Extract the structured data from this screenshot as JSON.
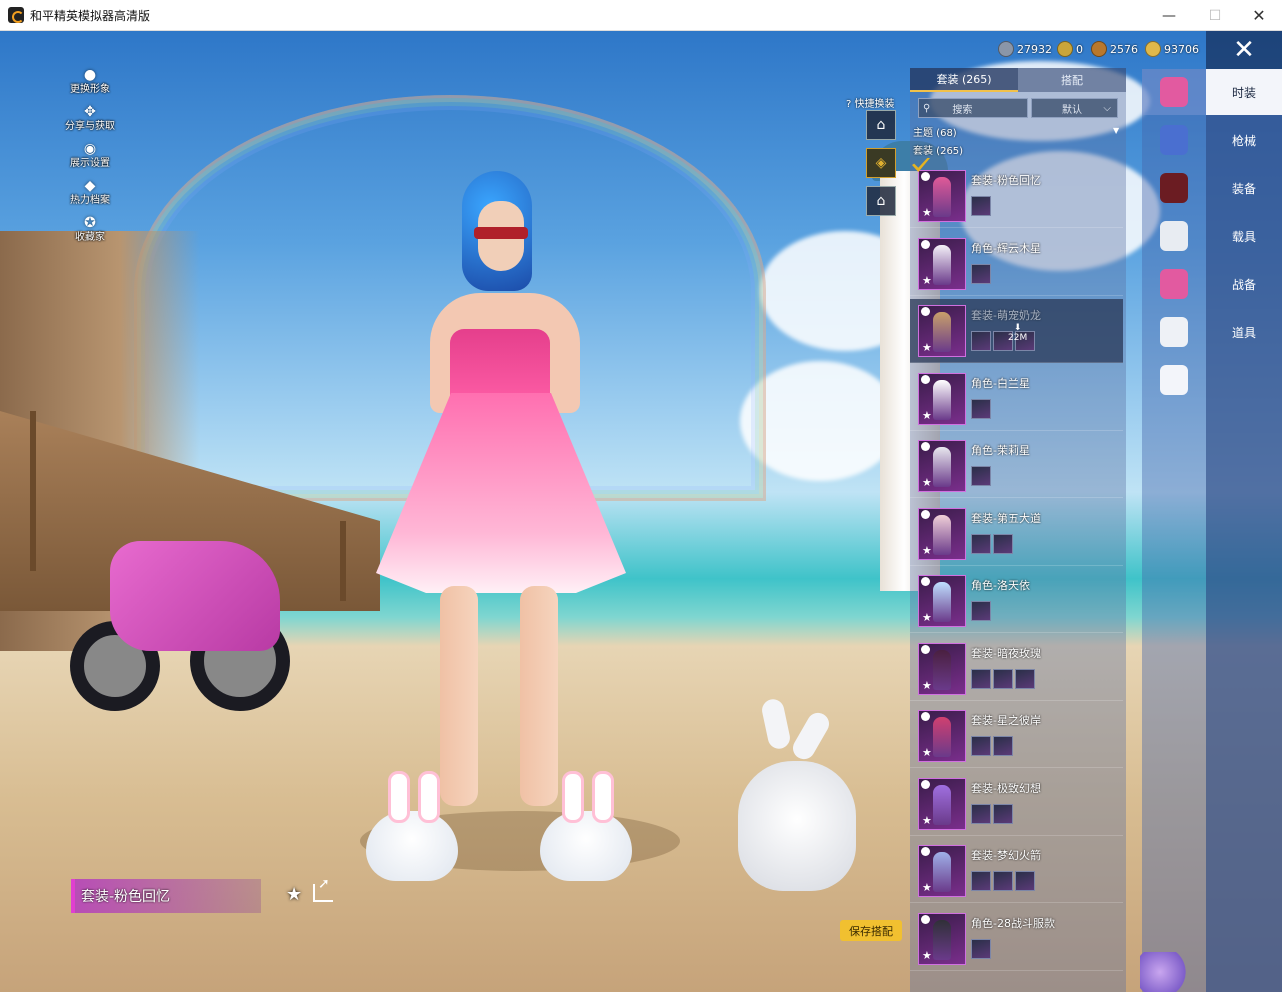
{
  "window": {
    "title": "和平精英模拟器高清版",
    "minimize": "—",
    "maximize": "☐",
    "close": "✕"
  },
  "left_menu": [
    {
      "label": "更换形象",
      "icon": "person-icon"
    },
    {
      "label": "分享与获取",
      "icon": "share-icon"
    },
    {
      "label": "展示设置",
      "icon": "eye-icon"
    },
    {
      "label": "热力档案",
      "icon": "profile-icon"
    },
    {
      "label": "收藏家",
      "icon": "collector-badge-icon"
    }
  ],
  "currency": [
    {
      "value": "27932",
      "color": "#8a96a8"
    },
    {
      "value": "0",
      "color": "#c9a53a"
    },
    {
      "value": "2576",
      "color": "#b9782c"
    },
    {
      "value": "93706",
      "color": "#e0b84a"
    }
  ],
  "close_button": "✕",
  "quick_change": {
    "label": "快捷换装"
  },
  "panel": {
    "tab_outfits": "套装 (265)",
    "tab_match": "搭配",
    "search_placeholder": "搜索",
    "sort_value": "默认",
    "group_theme": "主题 (68)",
    "group_outfits": "套装 (265)"
  },
  "outfits": [
    {
      "name": "套装-粉色回忆",
      "minis": 1,
      "selected": false,
      "checked": true
    },
    {
      "name": "角色-辉云木星",
      "minis": 1,
      "selected": false,
      "checked": false
    },
    {
      "name": "套装-萌宠奶龙",
      "minis": 3,
      "selected": true,
      "checked": false,
      "download": "22M"
    },
    {
      "name": "角色-白兰星",
      "minis": 1,
      "selected": false,
      "checked": false
    },
    {
      "name": "角色-茉莉星",
      "minis": 1,
      "selected": false,
      "checked": false
    },
    {
      "name": "套装-第五大道",
      "minis": 2,
      "selected": false,
      "checked": false
    },
    {
      "name": "角色-洛天依",
      "minis": 1,
      "selected": false,
      "checked": false
    },
    {
      "name": "套装-暗夜玫瑰",
      "minis": 3,
      "selected": false,
      "checked": false
    },
    {
      "name": "套装-星之彼岸",
      "minis": 2,
      "selected": false,
      "checked": false
    },
    {
      "name": "套装-极致幻想",
      "minis": 2,
      "selected": false,
      "checked": false
    },
    {
      "name": "套装-梦幻火箭",
      "minis": 3,
      "selected": false,
      "checked": false
    },
    {
      "name": "角色-28战斗服款",
      "minis": 1,
      "selected": false,
      "checked": false
    }
  ],
  "categories": [
    {
      "label": "时装",
      "icon": "outfit-icon",
      "active": true
    },
    {
      "label": "枪械",
      "icon": "gun-icon",
      "active": false
    },
    {
      "label": "装备",
      "icon": "helmet-icon",
      "active": false
    },
    {
      "label": "载具",
      "icon": "mask-icon",
      "active": false
    },
    {
      "label": "战备",
      "icon": "costume-icon",
      "active": false
    },
    {
      "label": "道具",
      "icon": "pants-icon",
      "active": false
    },
    {
      "label": "",
      "icon": "shoes-icon",
      "active": false
    }
  ],
  "current_outfit": "套装-粉色回忆",
  "save_button": "保存搭配",
  "colors": {
    "accent_gold": "#f1c030",
    "selection_purple": "#e040d0"
  }
}
